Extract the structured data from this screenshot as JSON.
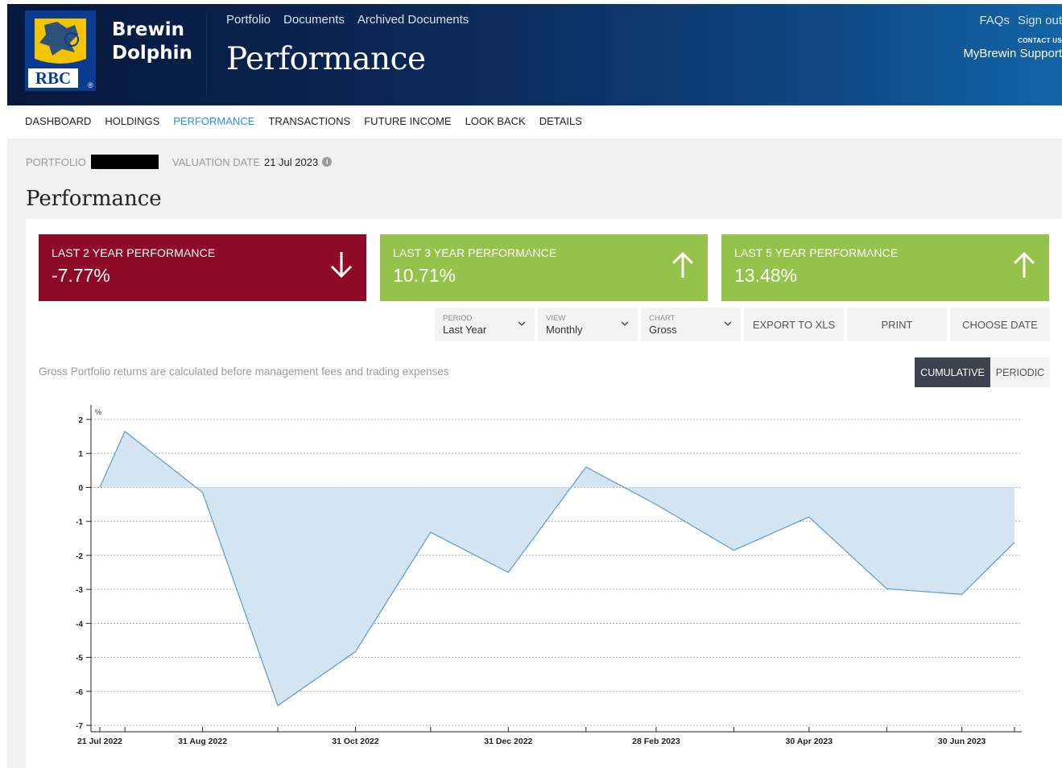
{
  "header": {
    "brand_line1": "Brewin",
    "brand_line2": "Dolphin",
    "logo_text": "RBC",
    "nav": [
      "Portfolio",
      "Documents",
      "Archived Documents"
    ],
    "title": "Performance",
    "right_links": [
      "FAQs",
      "Sign out"
    ],
    "contact_label": "CONTACT US",
    "support_text": "MyBrewin Support"
  },
  "subnav": {
    "items": [
      "DASHBOARD",
      "HOLDINGS",
      "PERFORMANCE",
      "TRANSACTIONS",
      "FUTURE INCOME",
      "LOOK BACK",
      "DETAILS"
    ],
    "active": "PERFORMANCE"
  },
  "meta": {
    "portfolio_label": "PORTFOLIO",
    "valuation_label": "VALUATION DATE",
    "valuation_date": "21 Jul 2023"
  },
  "page_title": "Performance",
  "cards": [
    {
      "title": "LAST 2 YEAR PERFORMANCE",
      "value": "-7.77%",
      "direction": "down",
      "color": "#8f0a26"
    },
    {
      "title": "LAST 3 YEAR PERFORMANCE",
      "value": "10.71%",
      "direction": "up",
      "color": "#95c24a"
    },
    {
      "title": "LAST 5 YEAR PERFORMANCE",
      "value": "13.48%",
      "direction": "up",
      "color": "#95c24a"
    }
  ],
  "controls": {
    "period": {
      "label": "PERIOD",
      "value": "Last Year"
    },
    "view": {
      "label": "VIEW",
      "value": "Monthly"
    },
    "chart": {
      "label": "CHART",
      "value": "Gross"
    },
    "export": "EXPORT TO XLS",
    "print": "PRINT",
    "choose_date": "CHOOSE DATE"
  },
  "note": "Gross Portfolio returns are calculated before management fees and trading expenses",
  "toggle": {
    "cumulative": "CUMULATIVE",
    "periodic": "PERIODIC",
    "active": "CUMULATIVE"
  },
  "chart_data": {
    "type": "area",
    "ylabel": "%",
    "ylim": [
      -7,
      2
    ],
    "yticks": [
      2,
      1,
      0,
      -1,
      -2,
      -3,
      -4,
      -5,
      -6,
      -7
    ],
    "x": [
      "2022-07-21",
      "2022-07-31",
      "2022-08-31",
      "2022-09-30",
      "2022-10-31",
      "2022-11-30",
      "2022-12-31",
      "2023-01-31",
      "2023-02-28",
      "2023-03-31",
      "2023-04-30",
      "2023-05-31",
      "2023-06-30",
      "2023-07-21"
    ],
    "values": [
      0.0,
      1.65,
      -0.15,
      -6.42,
      -4.83,
      -1.32,
      -2.5,
      0.6,
      -0.5,
      -1.85,
      -0.87,
      -2.98,
      -3.15,
      -1.62
    ],
    "xtick_labels": [
      "21 Jul 2022",
      "31 Aug 2022",
      "31 Oct 2022",
      "31 Dec 2022",
      "28 Feb 2023",
      "30 Apr 2023",
      "30 Jun 2023"
    ],
    "grid": true,
    "colors": {
      "line": "#5b9bd0",
      "fill": "#d4e4f0"
    }
  }
}
